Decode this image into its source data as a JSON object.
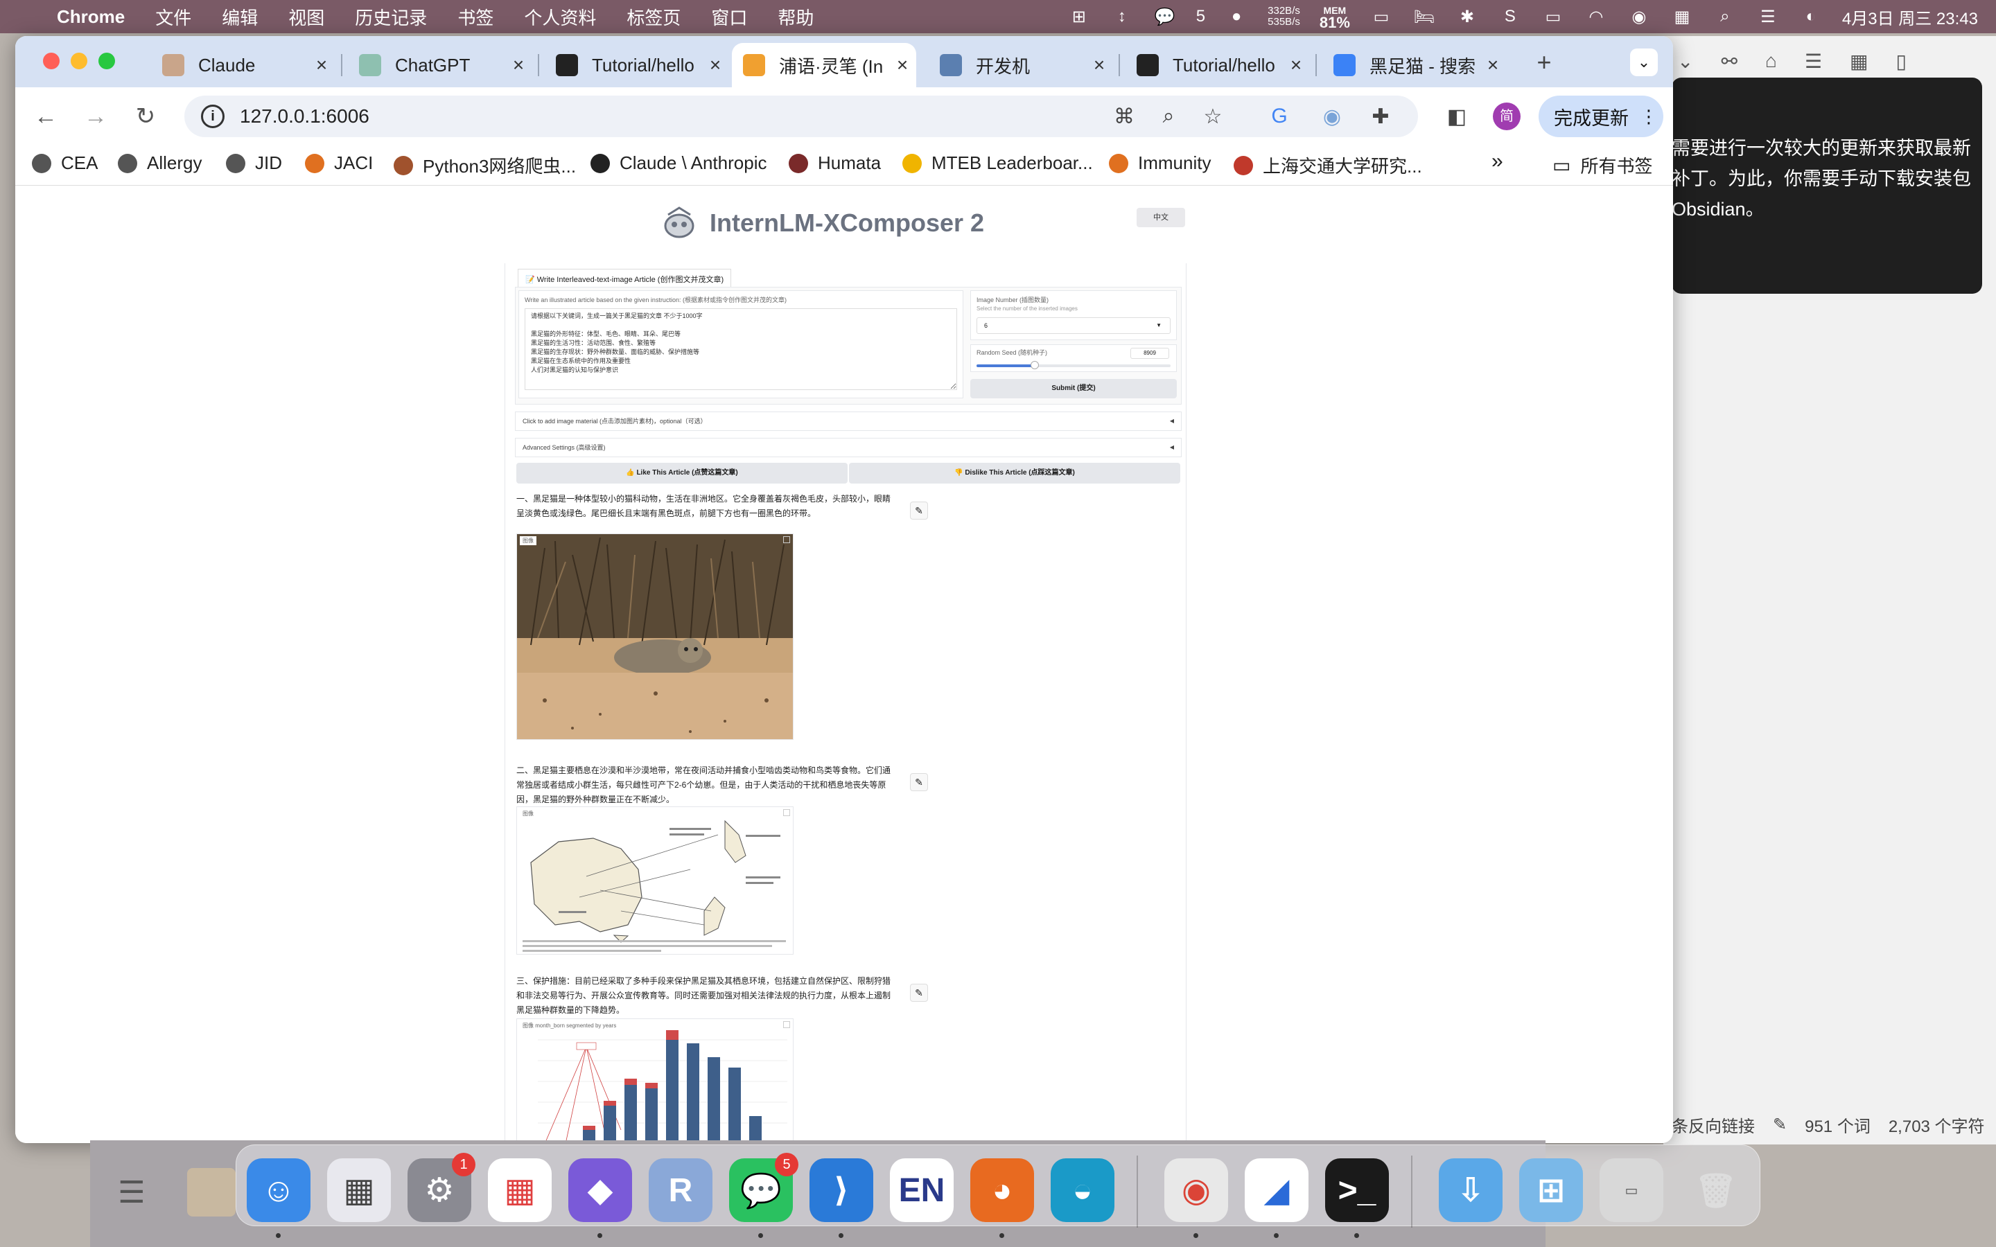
{
  "menubar": {
    "app_name": "Chrome",
    "menus": [
      "文件",
      "编辑",
      "视图",
      "历史记录",
      "书签",
      "个人资料",
      "标签页",
      "窗口",
      "帮助"
    ],
    "wechat_count": "5",
    "net_up": "332B/s",
    "net_down": "535B/s",
    "mem_label": "MEM",
    "mem_value": "81%",
    "datetime": "4月3日 周三  23:43"
  },
  "tabs": [
    {
      "title": "Claude",
      "icon": "anthropic-icon",
      "color": "#c9a58a"
    },
    {
      "title": "ChatGPT",
      "icon": "openai-icon",
      "color": "#8ec0b0"
    },
    {
      "title": "Tutorial/hello",
      "icon": "github-icon",
      "color": "#222"
    },
    {
      "title": "浦语·灵笔 (In",
      "icon": "internlm-icon",
      "color": "#f0a030",
      "active": true
    },
    {
      "title": "开发机",
      "icon": "robot-icon",
      "color": "#5b7fb0"
    },
    {
      "title": "Tutorial/hello",
      "icon": "github-icon",
      "color": "#222"
    },
    {
      "title": "黑足猫 - 搜索",
      "icon": "search-icon",
      "color": "#3b82f6"
    }
  ],
  "toolbar": {
    "url": "127.0.0.1:6006",
    "profile_initial": "简",
    "update_label": "完成更新"
  },
  "bookmarks": [
    {
      "label": "CEA",
      "color": "#555"
    },
    {
      "label": "Allergy",
      "color": "#555"
    },
    {
      "label": "JID",
      "color": "#555"
    },
    {
      "label": "JACI",
      "color": "#e07020"
    },
    {
      "label": "Python3网络爬虫...",
      "color": "#a0522d"
    },
    {
      "label": "Claude \\ Anthropic",
      "color": "#222"
    },
    {
      "label": "Humata",
      "color": "#7a2a2a"
    },
    {
      "label": "MTEB Leaderboar...",
      "color": "#f0b400"
    },
    {
      "label": "Immunity",
      "color": "#e07020"
    },
    {
      "label": "上海交通大学研究...",
      "color": "#c0392b"
    }
  ],
  "bookmarks_all": "所有书签",
  "app": {
    "title": "InternLM-XComposer 2",
    "lang_button": "中文",
    "tab_label": "📝 Write Interleaved-text-image Article (创作图文并茂文章)",
    "instruction_label": "Write an illustrated article based on the given instruction: (根据素材或指令创作图文并茂的文章)",
    "instruction_text": "请根据以下关键词，生成一篇关于黑足猫的文章 不少于1000字\n\n黑足猫的外形特征：体型、毛色、眼睛、耳朵、尾巴等\n黑足猫的生活习性：活动范围、食性、繁殖等\n黑足猫的生存现状：野外种群数量、面临的威胁、保护措施等\n黑足猫在生态系统中的作用及重要性\n人们对黑足猫的认知与保护意识",
    "image_number_label": "Image Number (插图数量)",
    "image_number_sub": "Select the number of the inserted images",
    "image_number_value": "6",
    "seed_label": "Random Seed (随机种子)",
    "seed_value": "8909",
    "seed_fraction": 0.3,
    "submit_label": "Submit (提交)",
    "add_material_label": "Click to add image material (点击添加图片素材)，optional（可选）",
    "advanced_label": "Advanced Settings (高级设置)",
    "like_label": "👍 Like This Article (点赞这篇文章)",
    "dislike_label": "👎 Dislike This Article (点踩这篇文章)",
    "image_tag": "图像",
    "chart_caption": "month_born segmented by years",
    "paragraphs": [
      "一、黑足猫是一种体型较小的猫科动物，生活在非洲地区。它全身覆盖着灰褐色毛皮，头部较小，眼睛呈淡黄色或浅绿色。尾巴细长且末端有黑色斑点，前腿下方也有一圈黑色的环带。",
      "二、黑足猫主要栖息在沙漠和半沙漠地带，常在夜间活动并捕食小型啮齿类动物和鸟类等食物。它们通常独居或者结成小群生活，每只雌性可产下2-6个幼崽。但是，由于人类活动的干扰和栖息地丧失等原因，黑足猫的野外种群数量正在不断减少。",
      "三、保护措施：目前已经采取了多种手段来保护黑足猫及其栖息环境，包括建立自然保护区、限制狩猎和非法交易等行为、开展公众宣传教育等。同时还需要加强对相关法律法规的执行力度，从根本上遏制黑足猫种群数量的下降趋势。"
    ]
  },
  "obsidian": {
    "notice_lines": [
      "需要进行一次较大的更新来获取最新",
      "补丁。为此，你需要手动下载安装包",
      "Obsidian。"
    ],
    "backlinks": "条反向链接",
    "words": "951 个词",
    "chars": "2,703 个字符"
  },
  "dock": {
    "settings_badge": "1",
    "wechat_badge": "5"
  }
}
